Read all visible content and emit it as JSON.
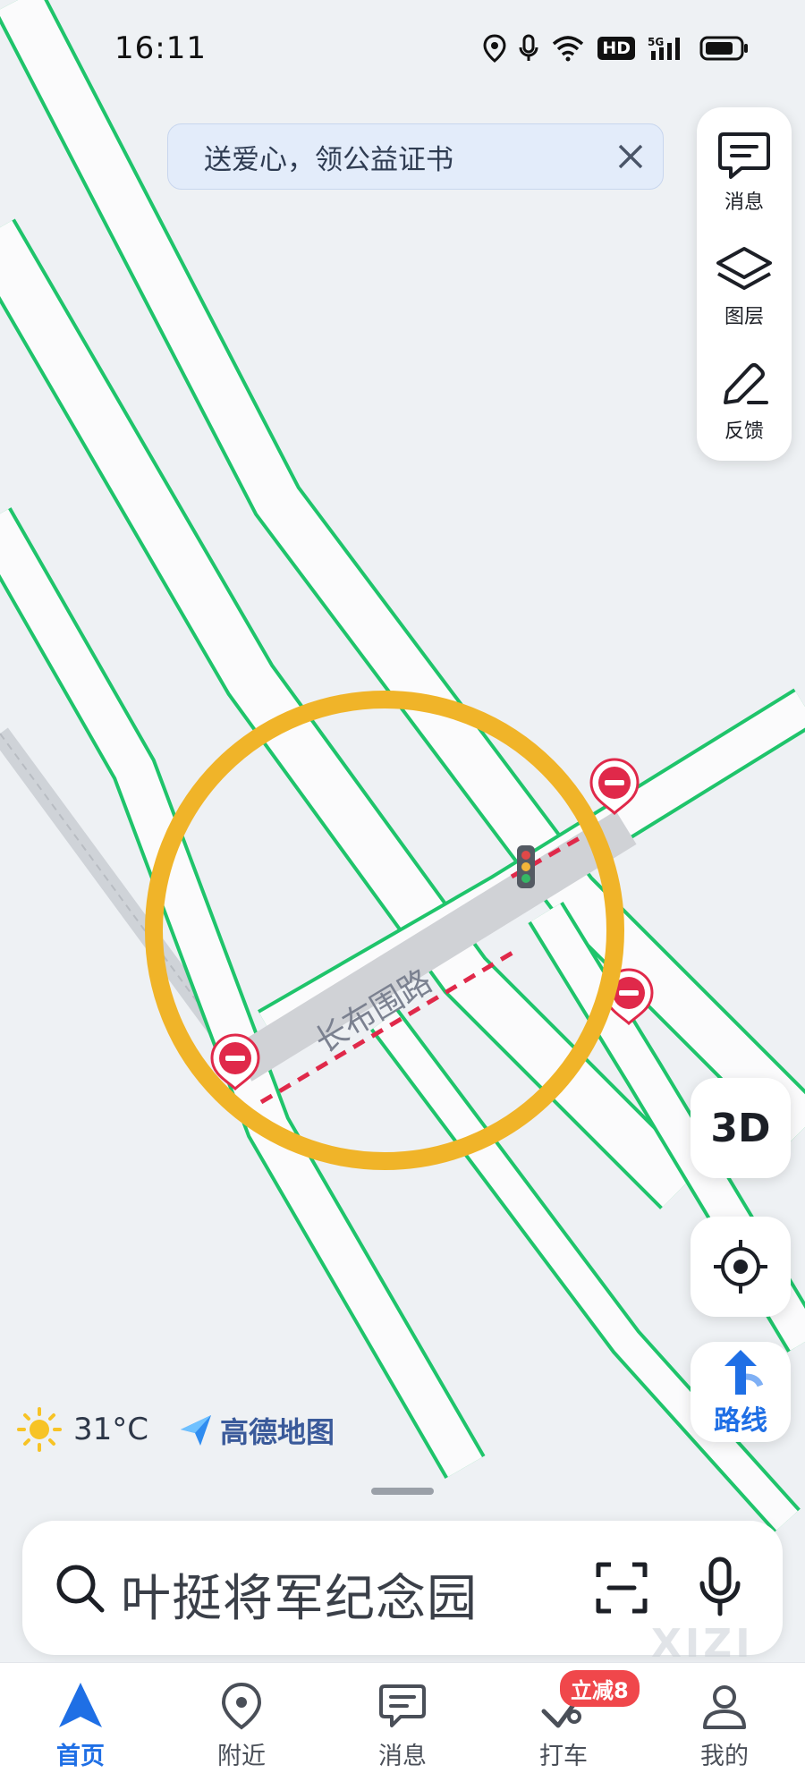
{
  "status_bar": {
    "time": "16:11",
    "network": "5G",
    "hd": "HD"
  },
  "promo": {
    "text": "送爱心，领公益证书"
  },
  "tools": [
    {
      "label": "消息",
      "icon": "message-icon"
    },
    {
      "label": "图层",
      "icon": "layers-icon"
    },
    {
      "label": "反馈",
      "icon": "feedback-edit-icon"
    }
  ],
  "map": {
    "road_name": "长布围路"
  },
  "buttons": {
    "three_d": "3D",
    "route": "路线"
  },
  "weather": {
    "temp": "31°C",
    "icon": "sun-icon"
  },
  "brand": {
    "name": "高德地图"
  },
  "search": {
    "placeholder": "叶挺将军纪念园"
  },
  "watermark": "XIZI",
  "nav": {
    "items": [
      {
        "label": "首页",
        "icon": "navigation-arrow-icon",
        "active": true
      },
      {
        "label": "附近",
        "icon": "location-pin-icon"
      },
      {
        "label": "消息",
        "icon": "message-icon"
      },
      {
        "label": "打车",
        "icon": "taxi-icon",
        "badge": "立减8"
      },
      {
        "label": "我的",
        "icon": "person-icon"
      }
    ]
  },
  "colors": {
    "accent": "#1f6fe5",
    "road_edge": "#1fc46b",
    "highlight_ring": "#f0b429",
    "closure": "#e0294a"
  }
}
